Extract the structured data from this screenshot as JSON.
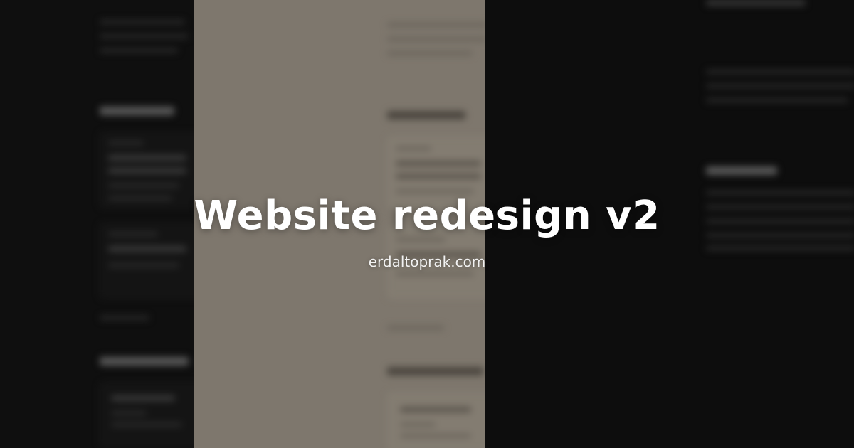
{
  "hero": {
    "title": "Website redesign v2",
    "domain": "erdaltoprak.com"
  },
  "colors": {
    "dark_background": "#0f0f0f",
    "middle_panel": "#7e776d",
    "title_text": "#ffffff"
  }
}
